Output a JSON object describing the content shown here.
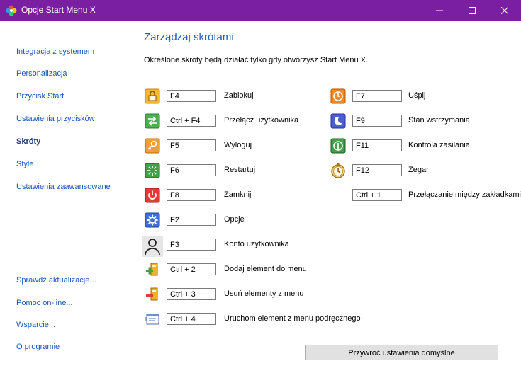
{
  "window": {
    "title": "Opcje Start Menu X"
  },
  "sidebar": {
    "items": [
      {
        "label": "Integracja z systemem",
        "active": false
      },
      {
        "label": "Personalizacja",
        "active": false
      },
      {
        "label": "Przycisk Start",
        "active": false
      },
      {
        "label": "Ustawienia przycisków",
        "active": false
      },
      {
        "label": "Skróty",
        "active": true
      },
      {
        "label": "Style",
        "active": false
      },
      {
        "label": "Ustawienia zaawansowane",
        "active": false
      }
    ],
    "bottom_items": [
      {
        "label": "Sprawdź aktualizacje..."
      },
      {
        "label": "Pomoc on-line..."
      },
      {
        "label": "Wsparcie..."
      },
      {
        "label": "O programie"
      }
    ]
  },
  "main": {
    "heading": "Zarządzaj skrótami",
    "description": "Określone skróty będą działać tylko gdy otworzysz Start Menu X.",
    "left_shortcuts": [
      {
        "icon": "lock-icon",
        "key": "F4",
        "label": "Zablokuj"
      },
      {
        "icon": "switch-user-icon",
        "key": "Ctrl + F4",
        "label": "Przełącz użytkownika"
      },
      {
        "icon": "logoff-key-icon",
        "key": "F5",
        "label": "Wyloguj"
      },
      {
        "icon": "restart-icon",
        "key": "F6",
        "label": "Restartuj"
      },
      {
        "icon": "power-icon",
        "key": "F8",
        "label": "Zamknij"
      },
      {
        "icon": "gear-icon",
        "key": "F2",
        "label": "Opcje"
      },
      {
        "icon": "user-account-icon",
        "key": "F3",
        "label": "Konto użytkownika"
      },
      {
        "icon": "add-to-menu-icon",
        "key": "Ctrl + 2",
        "label": "Dodaj element do menu"
      },
      {
        "icon": "remove-from-menu-icon",
        "key": "Ctrl + 3",
        "label": "Usuń elementy z menu"
      },
      {
        "icon": "run-context-item-icon",
        "key": "Ctrl + 4",
        "label": "Uruchom element z menu podręcznego"
      }
    ],
    "right_shortcuts": [
      {
        "icon": "sleep-icon",
        "key": "F7",
        "label": "Uśpij"
      },
      {
        "icon": "hibernate-moon-icon",
        "key": "F9",
        "label": "Stan wstrzymania"
      },
      {
        "icon": "power-control-icon",
        "key": "F11",
        "label": "Kontrola zasilania"
      },
      {
        "icon": "clock-icon",
        "key": "F12",
        "label": "Zegar"
      },
      {
        "icon": "",
        "key": "Ctrl + 1",
        "label": "Przełączanie między zakładkami"
      }
    ],
    "reset_button": "Przywróć ustawienia domyślne"
  },
  "colors": {
    "titlebar": "#7b1fa2",
    "link": "#1a56b8",
    "heading": "#1f5fbf"
  }
}
